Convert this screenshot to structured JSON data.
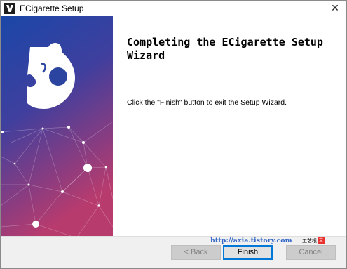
{
  "window": {
    "title": "ECigarette Setup",
    "close_glyph": "✕"
  },
  "sidebar": {
    "logo_icon": "puzzle-piece-logo-icon",
    "gradient_top": "#1a47a8",
    "gradient_bottom": "#b83b6e"
  },
  "content": {
    "heading": "Completing the ECigarette Setup Wizard",
    "body": "Click the \"Finish\" button to exit the Setup Wizard."
  },
  "watermark": {
    "url": "http://axia.tistory.com",
    "suffix": "工艺根",
    "badge": "文"
  },
  "buttons": {
    "back": "< Back",
    "finish": "Finish",
    "cancel": "Cancel"
  },
  "colors": {
    "accent": "#0078d7",
    "watermark": "#3569c8"
  }
}
